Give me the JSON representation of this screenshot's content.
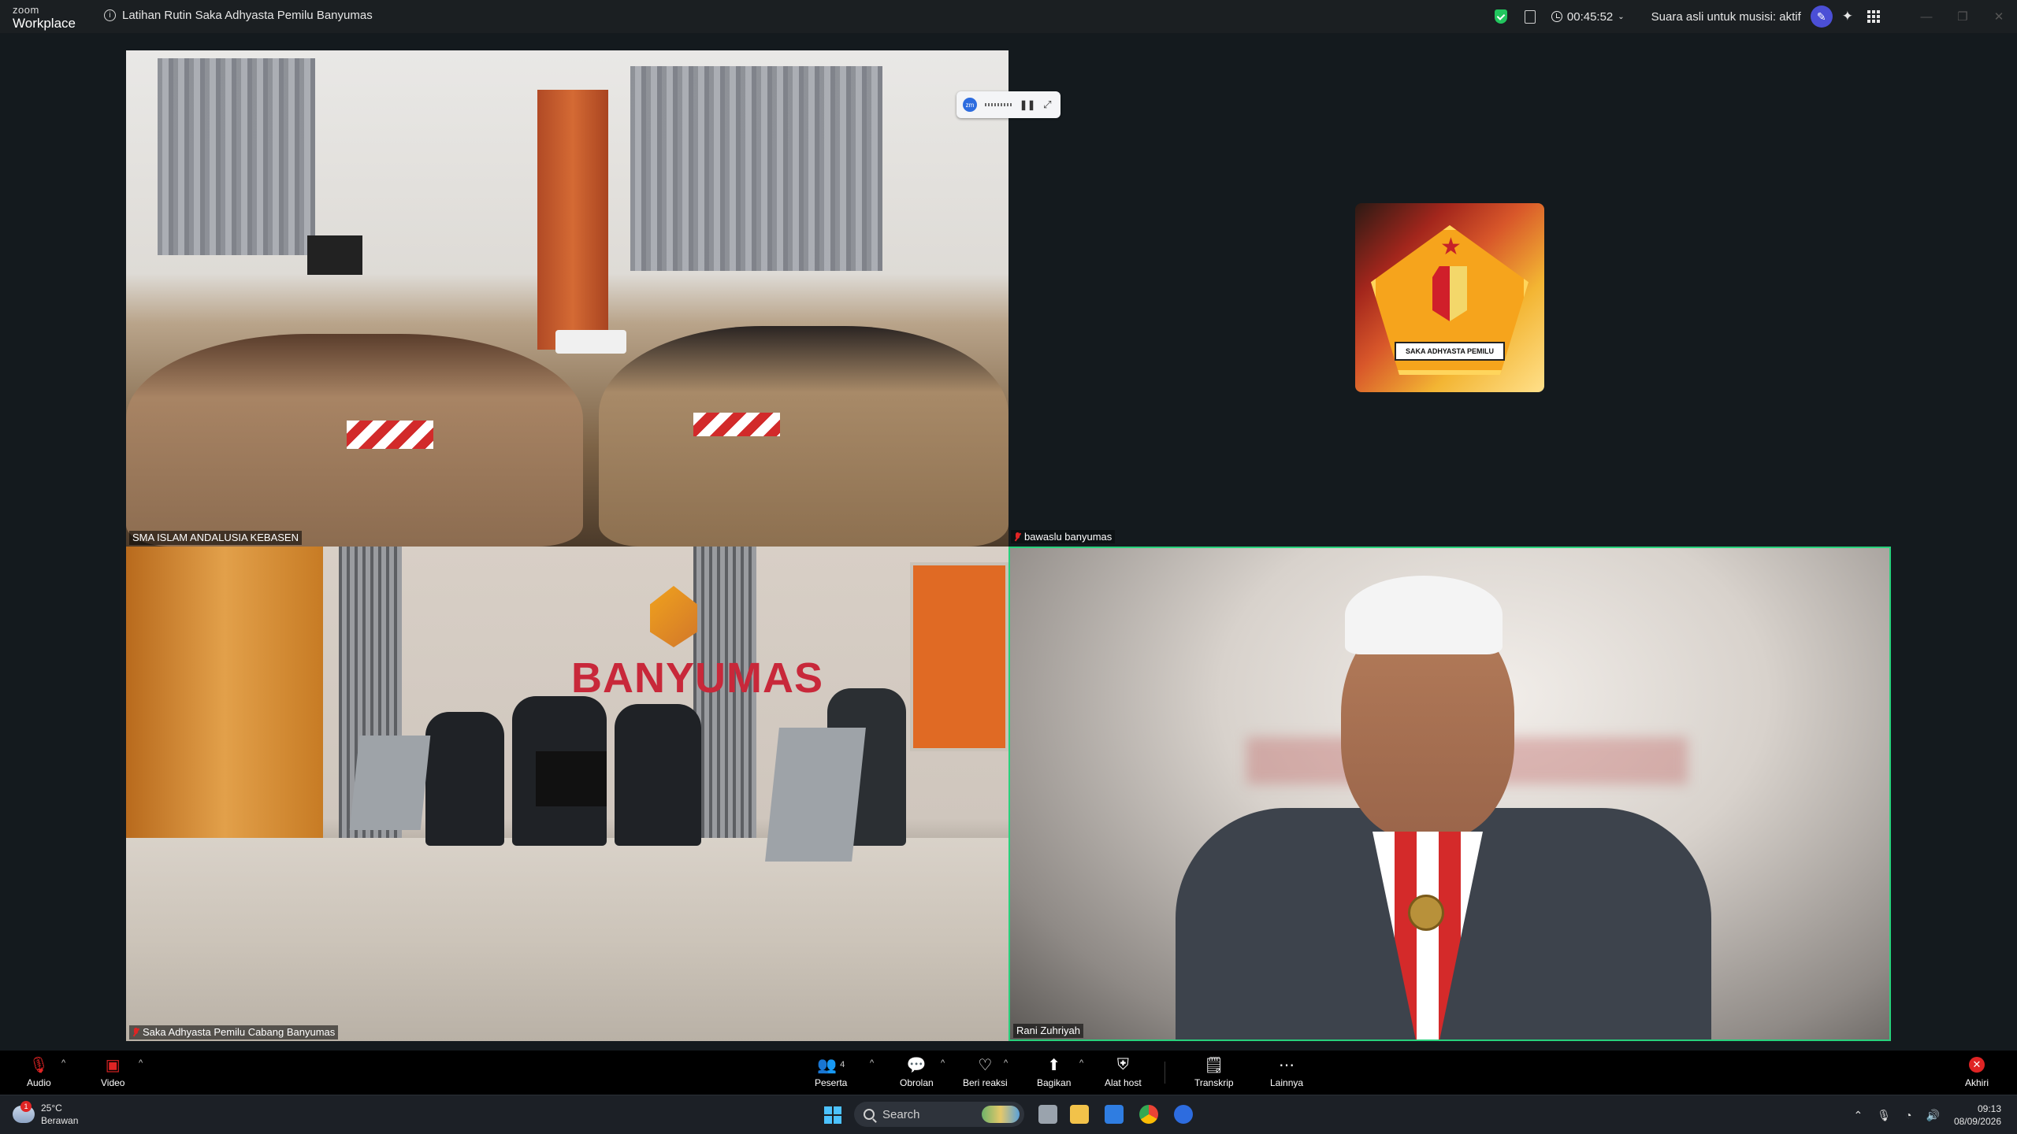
{
  "titlebar": {
    "brand_line1": "zoom",
    "brand_line2": "Workplace",
    "meeting_title": "Latihan Rutin Saka Adhyasta Pemilu Banyumas",
    "timer": "00:45:52",
    "original_sound": "Suara asli untuk musisi: aktif"
  },
  "tiles": [
    {
      "name": "SMA ISLAM ANDALUSIA KEBASEN"
    },
    {
      "name": "Saka Adhyasta Pemilu Cabang Banyumas"
    },
    {
      "name": "Rani Zuhriyah"
    },
    {
      "name": "bawaslu banyumas"
    }
  ],
  "tile2_sign": "BANYUMAS",
  "avatar_ribbon": "SAKA ADHYASTA PEMILU",
  "controls": {
    "audio": "Audio",
    "video": "Video",
    "participants": "Peserta",
    "participants_count": "4",
    "chat": "Obrolan",
    "react": "Beri reaksi",
    "share": "Bagikan",
    "host_tools": "Alat host",
    "transcript": "Transkrip",
    "more": "Lainnya",
    "end": "Akhiri"
  },
  "taskbar": {
    "temperature": "25°C",
    "weather": "Berawan",
    "search_placeholder": "Search",
    "time": "09:13",
    "date": "08/09/2026"
  },
  "colors": {
    "active_speaker_border": "#28d17c",
    "end_button": "#e02424",
    "security_shield": "#22c55e"
  }
}
